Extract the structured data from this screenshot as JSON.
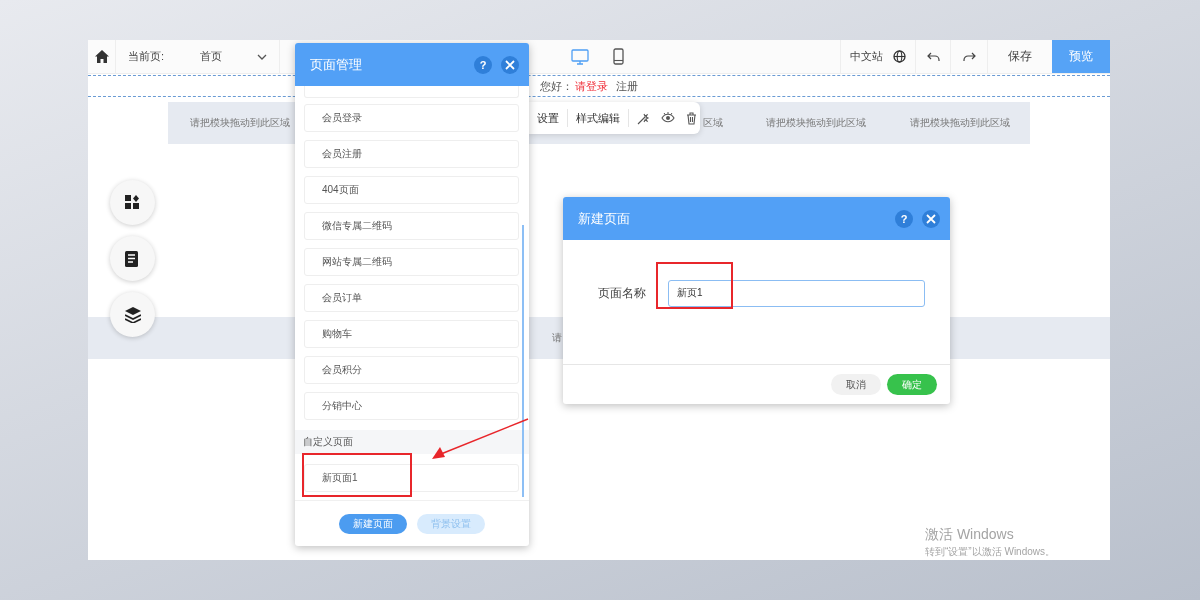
{
  "topbar": {
    "current_page_label": "当前页:",
    "current_page": "首页",
    "devices": [
      {
        "kind": "desktop",
        "selected": true
      },
      {
        "kind": "mobile",
        "selected": false
      }
    ],
    "language": "中文站",
    "save": "保存",
    "preview": "预览"
  },
  "header_strip": {
    "greeting": "您好：",
    "login": "请登录",
    "register": "注册"
  },
  "drop_band": {
    "cells": [
      {
        "text": "请把模块拖动到此区域"
      },
      {
        "text": "区域"
      },
      {
        "text": "请把模块拖动到此区域"
      },
      {
        "text": "请把模块拖动到此区域"
      }
    ]
  },
  "module_toolbar": {
    "items": [
      "设置",
      "样式编辑"
    ]
  },
  "lower_band": {
    "text": "请"
  },
  "side_tools": [
    {
      "kind": "modules"
    },
    {
      "kind": "pages"
    },
    {
      "kind": "layers"
    }
  ],
  "page_manager": {
    "title": "页面管理",
    "help": "?",
    "system_pages": [
      "会员登录",
      "会员注册",
      "404页面",
      "微信专属二维码",
      "网站专属二维码",
      "会员订单",
      "购物车",
      "会员积分",
      "分销中心"
    ],
    "section": "自定义页面",
    "custom_pages": [
      "新页面1"
    ],
    "buttons": [
      {
        "label": "新建页面",
        "kind": "primary"
      },
      {
        "label": "背景设置",
        "kind": "secondary"
      }
    ]
  },
  "new_page_dialog": {
    "title": "新建页面",
    "help": "?",
    "field_label": "页面名称",
    "field_value": "新页1",
    "buttons": [
      {
        "label": "取消",
        "kind": "secondary"
      },
      {
        "label": "确定",
        "kind": "primary"
      }
    ]
  },
  "watermark": {
    "title": "激活 Windows",
    "hint": "转到“设置”以激活 Windows。"
  }
}
